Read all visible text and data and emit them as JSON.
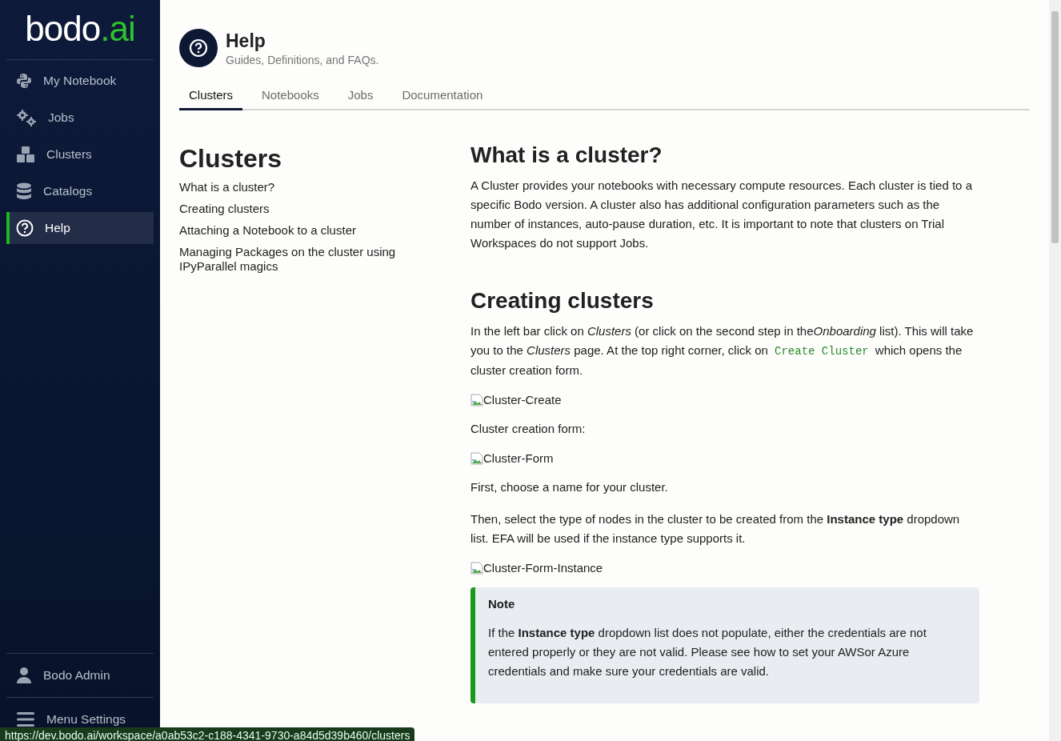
{
  "sidebar": {
    "logo": {
      "name": "bodo",
      "suffix": ".ai"
    },
    "items": [
      {
        "label": "My Notebook",
        "selected": false
      },
      {
        "label": "Jobs",
        "selected": false
      },
      {
        "label": "Clusters",
        "selected": false
      },
      {
        "label": "Catalogs",
        "selected": false
      },
      {
        "label": "Help",
        "selected": true
      }
    ],
    "footer": [
      {
        "label": "Bodo Admin"
      },
      {
        "label": "Menu Settings"
      }
    ]
  },
  "header": {
    "title": "Help",
    "subtitle": "Guides, Definitions, and FAQs."
  },
  "tabs": [
    {
      "label": "Clusters",
      "selected": true
    },
    {
      "label": "Notebooks",
      "selected": false
    },
    {
      "label": "Jobs",
      "selected": false
    },
    {
      "label": "Documentation",
      "selected": false
    }
  ],
  "toc": {
    "title": "Clusters",
    "links": [
      "What is a cluster?",
      "Creating clusters",
      "Attaching a Notebook to a cluster",
      "Managing Packages on the cluster using IPyParallel magics"
    ]
  },
  "content": [
    {
      "kind": "heading",
      "text": "What is a cluster?"
    },
    {
      "kind": "paragraph",
      "parts": [
        {
          "kind": "text",
          "text": "A Cluster provides your notebooks with necessary compute resources. Each cluster is tied to a specific Bodo version. A cluster also has additional configuration parameters such as the number of instances, auto-pause duration, etc. It is important to note that clusters on Trial Workspaces do not support Jobs."
        }
      ]
    },
    {
      "kind": "heading",
      "text": "Creating clusters"
    },
    {
      "kind": "paragraph",
      "parts": [
        {
          "kind": "text",
          "text": "In the left bar click on *Clusters* (or click on the second step in the"
        },
        {
          "kind": "em",
          "text": "Onboarding"
        },
        {
          "kind": "text",
          "text": " list). This will take you to the *Clusters* page. At the top right corner, click on "
        },
        {
          "kind": "code",
          "text": "Create Cluster"
        },
        {
          "kind": "text",
          "text": " which opens the cluster creation form."
        }
      ]
    },
    {
      "kind": "image",
      "alt": "Cluster-Create"
    },
    {
      "kind": "paragraph",
      "parts": [
        {
          "kind": "text",
          "text": "Cluster creation form:"
        }
      ]
    },
    {
      "kind": "image",
      "alt": "Cluster-Form"
    },
    {
      "kind": "paragraph",
      "parts": [
        {
          "kind": "text",
          "text": "First, choose a name for your cluster."
        }
      ]
    },
    {
      "kind": "paragraph",
      "parts": [
        {
          "kind": "text",
          "text": "Then, select the type of nodes in the cluster to be created from the **Instance type** dropdown list. EFA will be used if the instance type supports it."
        }
      ]
    },
    {
      "kind": "image",
      "alt": "Cluster-Form-Instance"
    },
    {
      "kind": "note",
      "title": "Note",
      "text": "If the **Instance type** dropdown list does not populate, either the credentials are not entered properly or they are not valid. Please see how to set your AWSor Azure credentials and make sure your credentials are valid."
    }
  ],
  "status_url": "https://dev.bodo.ai/workspace/a0ab53c2-c188-4341-9730-a84d5d39b460/clusters"
}
